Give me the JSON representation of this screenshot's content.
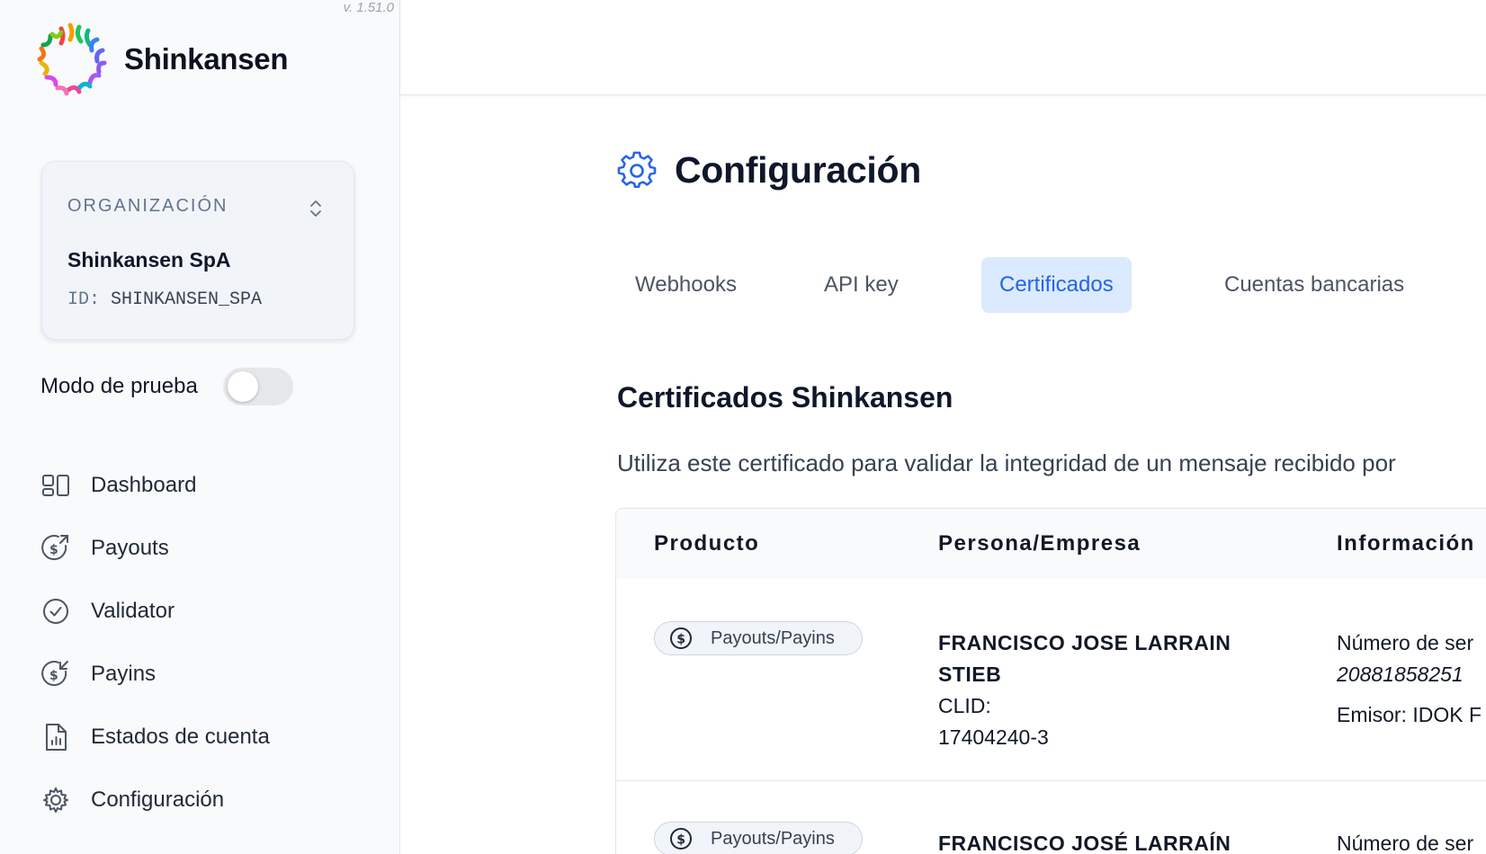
{
  "app": {
    "version": "v. 1.51.0",
    "brand_name": "Shinkansen"
  },
  "organization": {
    "label": "ORGANIZACIÓN",
    "name": "Shinkansen SpA",
    "id_prefix": "ID:",
    "id_value": "SHINKANSEN_SPA"
  },
  "test_mode": {
    "label": "Modo de prueba",
    "enabled": false
  },
  "nav": {
    "items": [
      {
        "label": "Dashboard",
        "icon": "dashboard-icon"
      },
      {
        "label": "Payouts",
        "icon": "payout-icon"
      },
      {
        "label": "Validator",
        "icon": "check-circle-icon"
      },
      {
        "label": "Payins",
        "icon": "payin-icon"
      },
      {
        "label": "Estados de cuenta",
        "icon": "document-chart-icon"
      },
      {
        "label": "Configuración",
        "icon": "gear-icon"
      }
    ]
  },
  "page": {
    "title": "Configuración",
    "tabs": [
      {
        "label": "Webhooks",
        "active": false
      },
      {
        "label": "API key",
        "active": false
      },
      {
        "label": "Certificados",
        "active": true
      },
      {
        "label": "Cuentas bancarias",
        "active": false
      }
    ],
    "section_title": "Certificados Shinkansen",
    "section_desc": "Utiliza este certificado para validar la integridad de un mensaje recibido por"
  },
  "table": {
    "headers": [
      "Producto",
      "Persona/Empresa",
      "Información"
    ],
    "rows": [
      {
        "product": "Payouts/Payins",
        "person_line1": "FRANCISCO JOSE LARRAIN",
        "person_line2": "STIEB",
        "clid_label": "CLID:",
        "clid_value": "17404240-3",
        "info_line1": "Número de ser",
        "info_line2": "20881858251",
        "info_line3": "Emisor: IDOK F"
      },
      {
        "product": "Payouts/Payins",
        "person_line1": "FRANCISCO JOSÉ LARRAÍN",
        "info_line1": "Número de ser"
      }
    ]
  },
  "colors": {
    "accent": "#2563eb",
    "tab_active_bg": "#dbeafe",
    "sidebar_bg": "#f8fafc"
  }
}
